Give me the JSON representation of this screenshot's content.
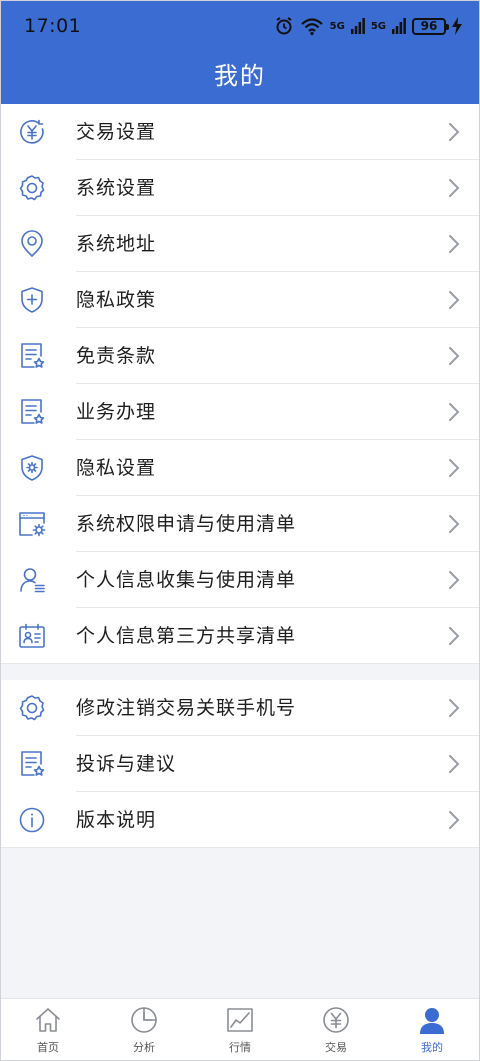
{
  "status_bar": {
    "time": "17:01",
    "signal_1": "5G",
    "signal_2": "5G",
    "battery": "96"
  },
  "header": {
    "title": "我的"
  },
  "menu_group_1": [
    {
      "label": "交易设置",
      "icon": "yuan-icon"
    },
    {
      "label": "系统设置",
      "icon": "gear-icon"
    },
    {
      "label": "系统地址",
      "icon": "location-icon"
    },
    {
      "label": "隐私政策",
      "icon": "shield-plus-icon"
    },
    {
      "label": "免责条款",
      "icon": "document-star-icon"
    },
    {
      "label": "业务办理",
      "icon": "document-star-icon"
    },
    {
      "label": "隐私设置",
      "icon": "shield-gear-icon"
    },
    {
      "label": "系统权限申请与使用清单",
      "icon": "window-gear-icon"
    },
    {
      "label": "个人信息收集与使用清单",
      "icon": "user-list-icon"
    },
    {
      "label": "个人信息第三方共享清单",
      "icon": "id-card-icon"
    }
  ],
  "menu_group_2": [
    {
      "label": "修改注销交易关联手机号",
      "icon": "gear-icon"
    },
    {
      "label": "投诉与建议",
      "icon": "document-star-icon"
    },
    {
      "label": "版本说明",
      "icon": "info-icon"
    }
  ],
  "tabbar": [
    {
      "label": "首页",
      "icon": "home-icon",
      "active": false
    },
    {
      "label": "分析",
      "icon": "pie-chart-icon",
      "active": false
    },
    {
      "label": "行情",
      "icon": "line-chart-icon",
      "active": false
    },
    {
      "label": "交易",
      "icon": "yuan-circle-icon",
      "active": false
    },
    {
      "label": "我的",
      "icon": "person-icon",
      "active": true
    }
  ],
  "colors": {
    "header_blue": "#3a6cd1",
    "icon_blue": "#4a74c9",
    "background": "#f3f4f7"
  }
}
